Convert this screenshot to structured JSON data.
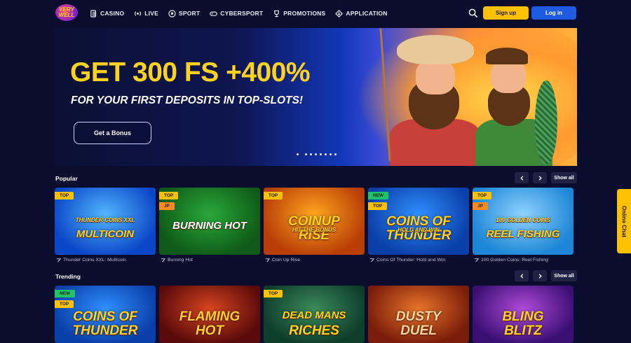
{
  "header": {
    "logo_text": "VERY WELL",
    "nav": [
      {
        "label": "CASINO",
        "icon": "cards-icon"
      },
      {
        "label": "LIVE",
        "icon": "broadcast-icon"
      },
      {
        "label": "SPORT",
        "icon": "ball-icon"
      },
      {
        "label": "CYBERSPORT",
        "icon": "gamepad-icon"
      },
      {
        "label": "PROMOTIONS",
        "icon": "trophy-icon"
      },
      {
        "label": "APPLICATION",
        "icon": "download-icon"
      }
    ],
    "signup_label": "Sign up",
    "login_label": "Log in"
  },
  "banner": {
    "title": "GET 300 FS +400%",
    "subtitle": "FOR YOUR FIRST DEPOSITS IN TOP-SLOTS!",
    "button_label": "Get a Bonus",
    "slide_count": 8,
    "active_slide": 0
  },
  "sections": [
    {
      "title": "Popular",
      "show_all_label": "Show all",
      "games": [
        {
          "name": "Thunder Coins XXL: Multicoin",
          "badges": [
            "TOP"
          ],
          "logo_lines": [
            "THUNDER COINS XXL",
            "MULTICOIN"
          ],
          "bg": [
            "#0b46c7",
            "#52b6ff"
          ],
          "logo_color": "#ffd21f"
        },
        {
          "name": "Burning Hot",
          "badges": [
            "TOP",
            "JP"
          ],
          "logo_lines": [
            "BURNING HOT"
          ],
          "bg": [
            "#0f5a18",
            "#2aa83a"
          ],
          "logo_color": "#ffffff"
        },
        {
          "name": "Coin Up Rise",
          "badges": [
            "TOP"
          ],
          "logo_lines": [
            "COINUP",
            "RISE",
            "HIT THE BONUS"
          ],
          "bg": [
            "#b83d06",
            "#ffa51f"
          ],
          "logo_color": "#ffd21f"
        },
        {
          "name": "Coins Of Thunder: Hold and Win",
          "badges": [
            "NEW",
            "TOP"
          ],
          "logo_lines": [
            "COINS OF",
            "THUNDER",
            "HOLD AND WIN"
          ],
          "bg": [
            "#0a3ea8",
            "#2f8fff"
          ],
          "logo_color": "#ffd21f"
        },
        {
          "name": "100 Golden Coins: Reel Fishing",
          "badges": [
            "TOP",
            "JP"
          ],
          "logo_lines": [
            "100 GOLDEN COINS",
            "REEL FISHING"
          ],
          "bg": [
            "#1d86d6",
            "#8fd3ff"
          ],
          "logo_color": "#ffd21f"
        }
      ]
    },
    {
      "title": "Trending",
      "show_all_label": "Show all",
      "games": [
        {
          "name": "",
          "badges": [
            "NEW",
            "TOP"
          ],
          "logo_lines": [
            "COINS OF",
            "THUNDER"
          ],
          "bg": [
            "#0a3ea8",
            "#2f8fff"
          ],
          "logo_color": "#ffd21f"
        },
        {
          "name": "",
          "badges": [],
          "logo_lines": [
            "FLAMING",
            "HOT"
          ],
          "bg": [
            "#5a0a0a",
            "#d7451f"
          ],
          "logo_color": "#ffcf3a"
        },
        {
          "name": "",
          "badges": [
            "TOP"
          ],
          "logo_lines": [
            "DEAD MANS",
            "RICHES"
          ],
          "bg": [
            "#0f3d2c",
            "#3a8a5a"
          ],
          "logo_color": "#ffd21f"
        },
        {
          "name": "",
          "badges": [],
          "logo_lines": [
            "DUSTY",
            "DUEL"
          ],
          "bg": [
            "#7a1c0a",
            "#e8742a"
          ],
          "logo_color": "#ffd8a0"
        },
        {
          "name": "",
          "badges": [],
          "logo_lines": [
            "BLING",
            "BLITZ"
          ],
          "bg": [
            "#3a0f73",
            "#b04ad9"
          ],
          "logo_color": "#ffd21f"
        }
      ]
    }
  ],
  "online_chat_label": "Online Chat",
  "colors": {
    "background": "#0b0d2e",
    "accent_yellow": "#fdc100",
    "accent_blue": "#1f5be0"
  }
}
